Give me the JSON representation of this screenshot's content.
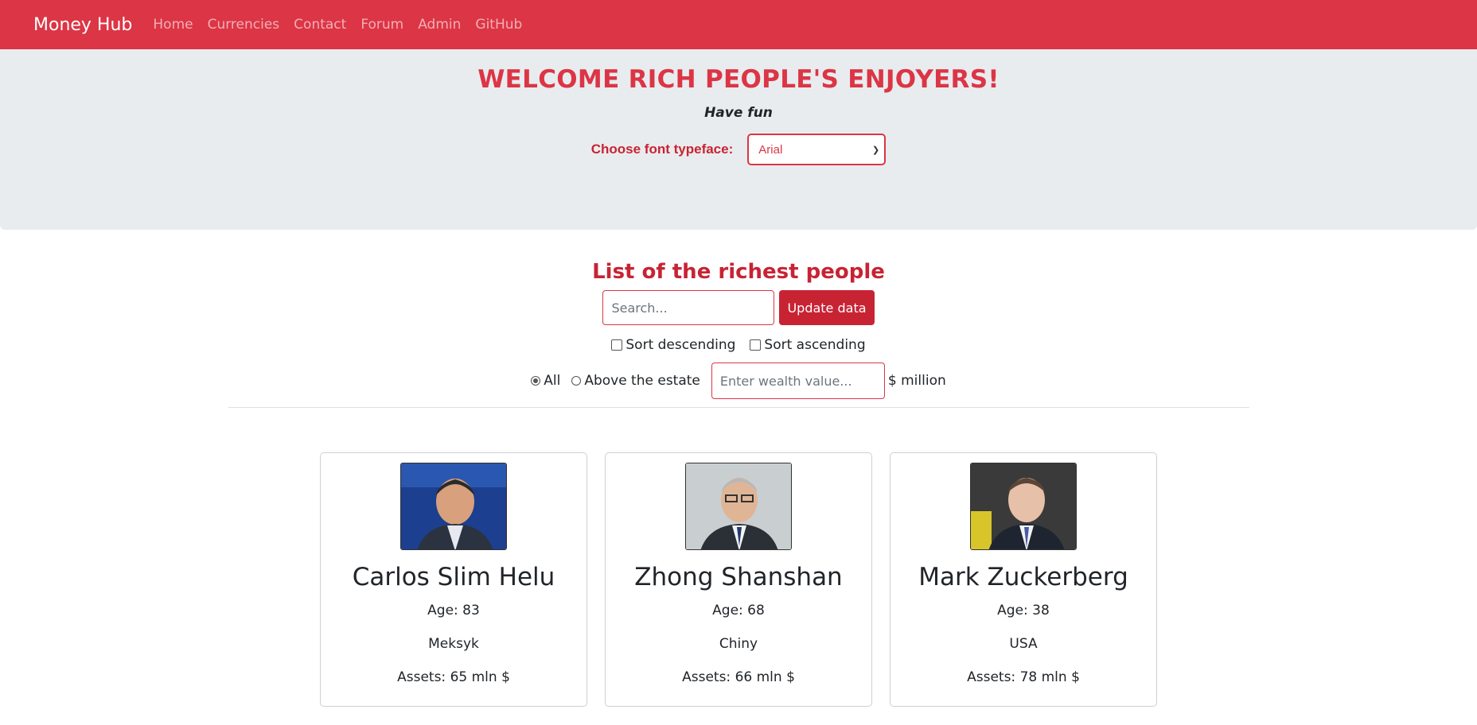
{
  "nav": {
    "brand": "Money Hub",
    "links": [
      "Home",
      "Currencies",
      "Contact",
      "Forum",
      "Admin",
      "GitHub"
    ]
  },
  "hero": {
    "title": "WELCOME RICH PEOPLE'S ENJOYERS!",
    "subtitle": "Have fun",
    "font_label": "Choose font typeface:",
    "font_selected": "Arial"
  },
  "list": {
    "title": "List of the richest people",
    "search_placeholder": "Search...",
    "update_button": "Update data",
    "sort_desc": "Sort descending",
    "sort_asc": "Sort ascending",
    "radio_all": "All",
    "radio_above": "Above the estate",
    "wealth_placeholder": "Enter wealth value...",
    "wealth_unit": "$ million"
  },
  "people": [
    {
      "name": "Carlos Slim Helu",
      "age": "Age: 83",
      "country": "Meksyk",
      "assets": "Assets: 65 mln $"
    },
    {
      "name": "Zhong Shanshan",
      "age": "Age: 68",
      "country": "Chiny",
      "assets": "Assets: 66 mln $"
    },
    {
      "name": "Mark Zuckerberg",
      "age": "Age: 38",
      "country": "USA",
      "assets": "Assets: 78 mln $"
    }
  ],
  "colors": {
    "accent": "#dc3545",
    "hero_bg": "#e9ecef"
  }
}
